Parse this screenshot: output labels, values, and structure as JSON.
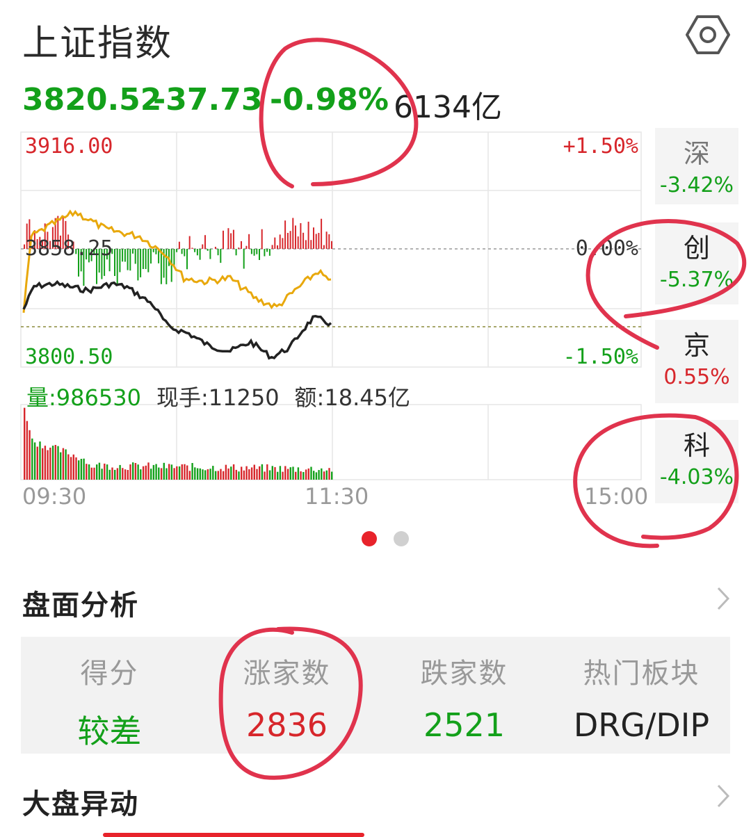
{
  "header": {
    "title": "上证指数",
    "settings_icon": "settings-hexagon-icon"
  },
  "quote": {
    "price": "3820.52",
    "change": "-37.73",
    "change_pct": "-0.98%",
    "amount": "6134亿"
  },
  "chart_labels": {
    "high_price": "3916.00",
    "prev_close": "3858.25",
    "low_price": "3800.50",
    "high_pct": "+1.50%",
    "zero_pct": "0.00%",
    "low_pct": "-1.50%"
  },
  "volume_row": {
    "vol_key": "量:",
    "vol_val": "986530",
    "hand_key": "现手:",
    "hand_val": "11250",
    "amt_key": "额:",
    "amt_val": "18.45亿"
  },
  "time_axis": [
    "09:30",
    "11:30",
    "15:00"
  ],
  "side_indices": [
    {
      "name": "深",
      "pct": "-3.42%",
      "color": "#13a01a"
    },
    {
      "name": "创",
      "pct": "-5.37%",
      "color": "#13a01a"
    },
    {
      "name": "京",
      "pct": "0.55%",
      "color": "#d7262b"
    },
    {
      "name": "科",
      "pct": "-4.03%",
      "color": "#13a01a"
    }
  ],
  "pager": {
    "active": 0,
    "count": 2
  },
  "analysis": {
    "title": "盘面分析",
    "cells": [
      {
        "label": "得分",
        "value": "较差",
        "color": "#13a01a"
      },
      {
        "label": "涨家数",
        "value": "2836",
        "color": "#d7262b"
      },
      {
        "label": "跌家数",
        "value": "2521",
        "color": "#13a01a"
      },
      {
        "label": "热门板块",
        "value": "DRG/DIP",
        "color": "#222222"
      }
    ]
  },
  "movement": {
    "title": "大盘异动"
  },
  "colors": {
    "up": "#d7262b",
    "down": "#13a01a",
    "price_line": "#222222",
    "avg_line": "#e8a80c",
    "annotation": "#e0334d"
  }
}
